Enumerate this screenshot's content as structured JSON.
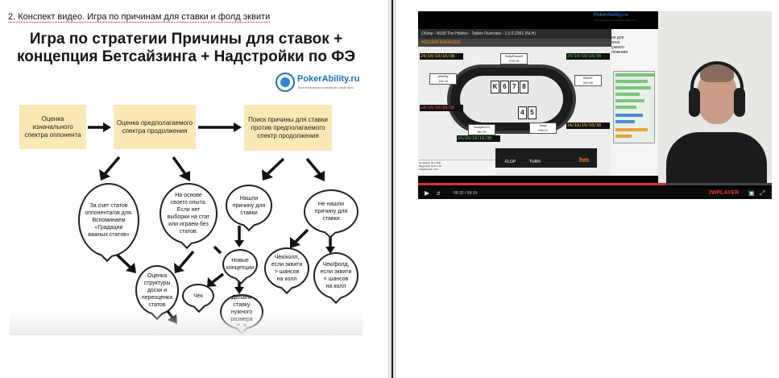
{
  "document": {
    "caption": "2. Конспект видео. Игра по причинам для ставки и фолд эквити"
  },
  "slide": {
    "title_line1": "Игра по стратегии Причины для ставок +",
    "title_line2": "концепция Бетсайзинга + Надстройки по ФЭ",
    "logo_name": "PokerAbility.ru",
    "logo_tag": "Твоя возможность выбрать свой путь!",
    "box1": "Оценка изначального спектра оппонента",
    "box2": "Оценка предполагаемого спектра продолжения",
    "box3": "Поиск причины для ставки против предполагаемого спектр продолжения",
    "bubble_stats": "За счет статов оппонента/ов для. Вспоминаем «Градации важных статов»",
    "bubble_experience": "На основе своего опыта. Если нет выборки на стат или играем без статов.",
    "bubble_found": "Нашли причину для ставки",
    "bubble_notfound": "Не нашли причину для ставки",
    "bubble_new": "Новые концепции",
    "bubble_check": "Чек",
    "bubble_size": "Делаем ставку нужного размера $$$",
    "bubble_board": "Оценка структуры доски и переоценка статов",
    "bubble_checkcall": "Чек/колл, если эквити > шансов на колл",
    "bubble_checkfold": "Чек/фолд, если эквити < шансов на колл"
  },
  "video": {
    "side_logo_name": "PokerAbility.ru",
    "side_logo_tag": "Твоя возможность выбрать свой путь!",
    "side_text": "ия для ятно ужного олжения",
    "poker": {
      "window_title": "Обзор - NL50 The Hidden - Tables Overview - 1.0.0.2301 (NLH)",
      "app_brand": "HOLDEM MANAGER",
      "board_cards": [
        "K",
        "6",
        "7",
        "8"
      ],
      "hero_cards": [
        "4",
        "5"
      ],
      "pot": "37.00",
      "flop_label": "FLOP",
      "turn_label": "TURN",
      "brand_badge": "hm",
      "seat_names": [
        "sfreetty",
        "SullyRussell",
        "MaxxF",
        "Jesyl",
        "Anstyle123"
      ],
      "seat_stacks": [
        "110.15",
        "270.70",
        "200.00",
        "218.21",
        "80.79"
      ],
      "hud_sample": "24/10/10/10/38",
      "log_lines": [
        "NLHoldem 50 1.25$",
        "BiggerFish NLH 1.75",
        "SullyRussell - 8.6..."
      ]
    },
    "player": {
      "time": "06:32 / 09:19",
      "brand": "JWPLAYER",
      "progress_fraction": 0.7,
      "accent_color": "#e0302b"
    }
  }
}
